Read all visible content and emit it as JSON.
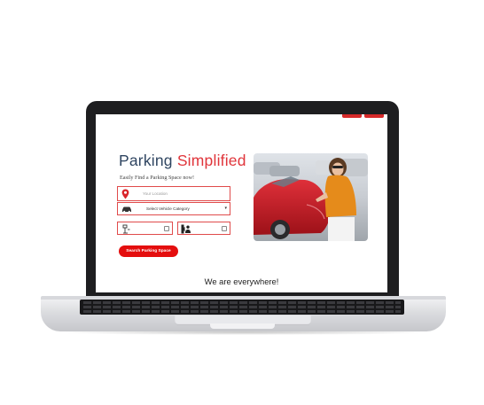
{
  "hero": {
    "title_part1": "Parking",
    "title_part2": "Simplified",
    "subtitle": "Easily Find a Parking Space now!"
  },
  "form": {
    "location_placeholder": "Your Location",
    "vehicle_category": "Select Vehicle Category",
    "search_button": "Search Parking Space"
  },
  "footer": {
    "tagline": "We are everywhere!"
  },
  "colors": {
    "accent_red": "#e40e0e",
    "title_navy": "#2f4561",
    "title_red": "#e0353b"
  },
  "icons": [
    "map-pin-icon",
    "car-icon",
    "parking-entry-icon",
    "exit-person-icon",
    "dropdown-caret-icon",
    "calendar-icon"
  ]
}
